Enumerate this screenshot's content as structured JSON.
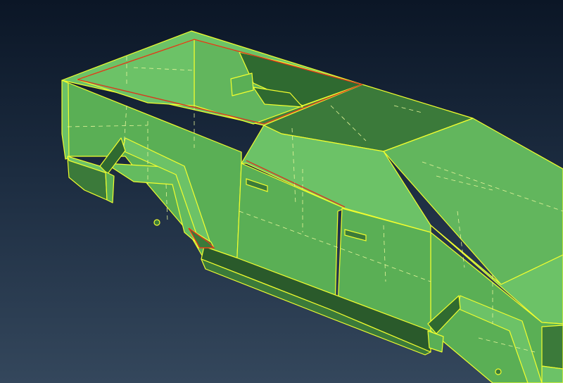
{
  "viewport": {
    "background_top": "#0b1626",
    "background_bottom": "#34475c"
  },
  "model": {
    "face_light": "#6cc267",
    "face_mid": "#5aaf55",
    "face_dark": "#3b7a3a",
    "face_shadow": "#27502a",
    "edge_color": "#f2ff2e",
    "selected_edge_color": "#d83a1e",
    "hidden_edge_style": "dashed"
  }
}
